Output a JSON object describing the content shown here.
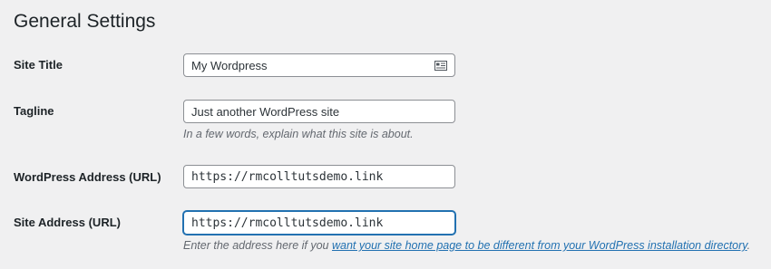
{
  "page": {
    "title": "General Settings"
  },
  "fields": {
    "site_title": {
      "label": "Site Title",
      "value": "My Wordpress",
      "icon": "contact-card-icon"
    },
    "tagline": {
      "label": "Tagline",
      "value": "Just another WordPress site",
      "description": "In a few words, explain what this site is about."
    },
    "wordpress_address": {
      "label": "WordPress Address (URL)",
      "value": "https://rmcolltutsdemo.link"
    },
    "site_address": {
      "label": "Site Address (URL)",
      "value": "https://rmcolltutsdemo.link",
      "description_prefix": "Enter the address here if you ",
      "description_link": "want your site home page to be different from your WordPress installation directory",
      "description_suffix": "."
    }
  },
  "colors": {
    "background": "#f0f0f1",
    "link": "#2271b1",
    "focus_border": "#2271b1",
    "muted_text": "#646970"
  }
}
